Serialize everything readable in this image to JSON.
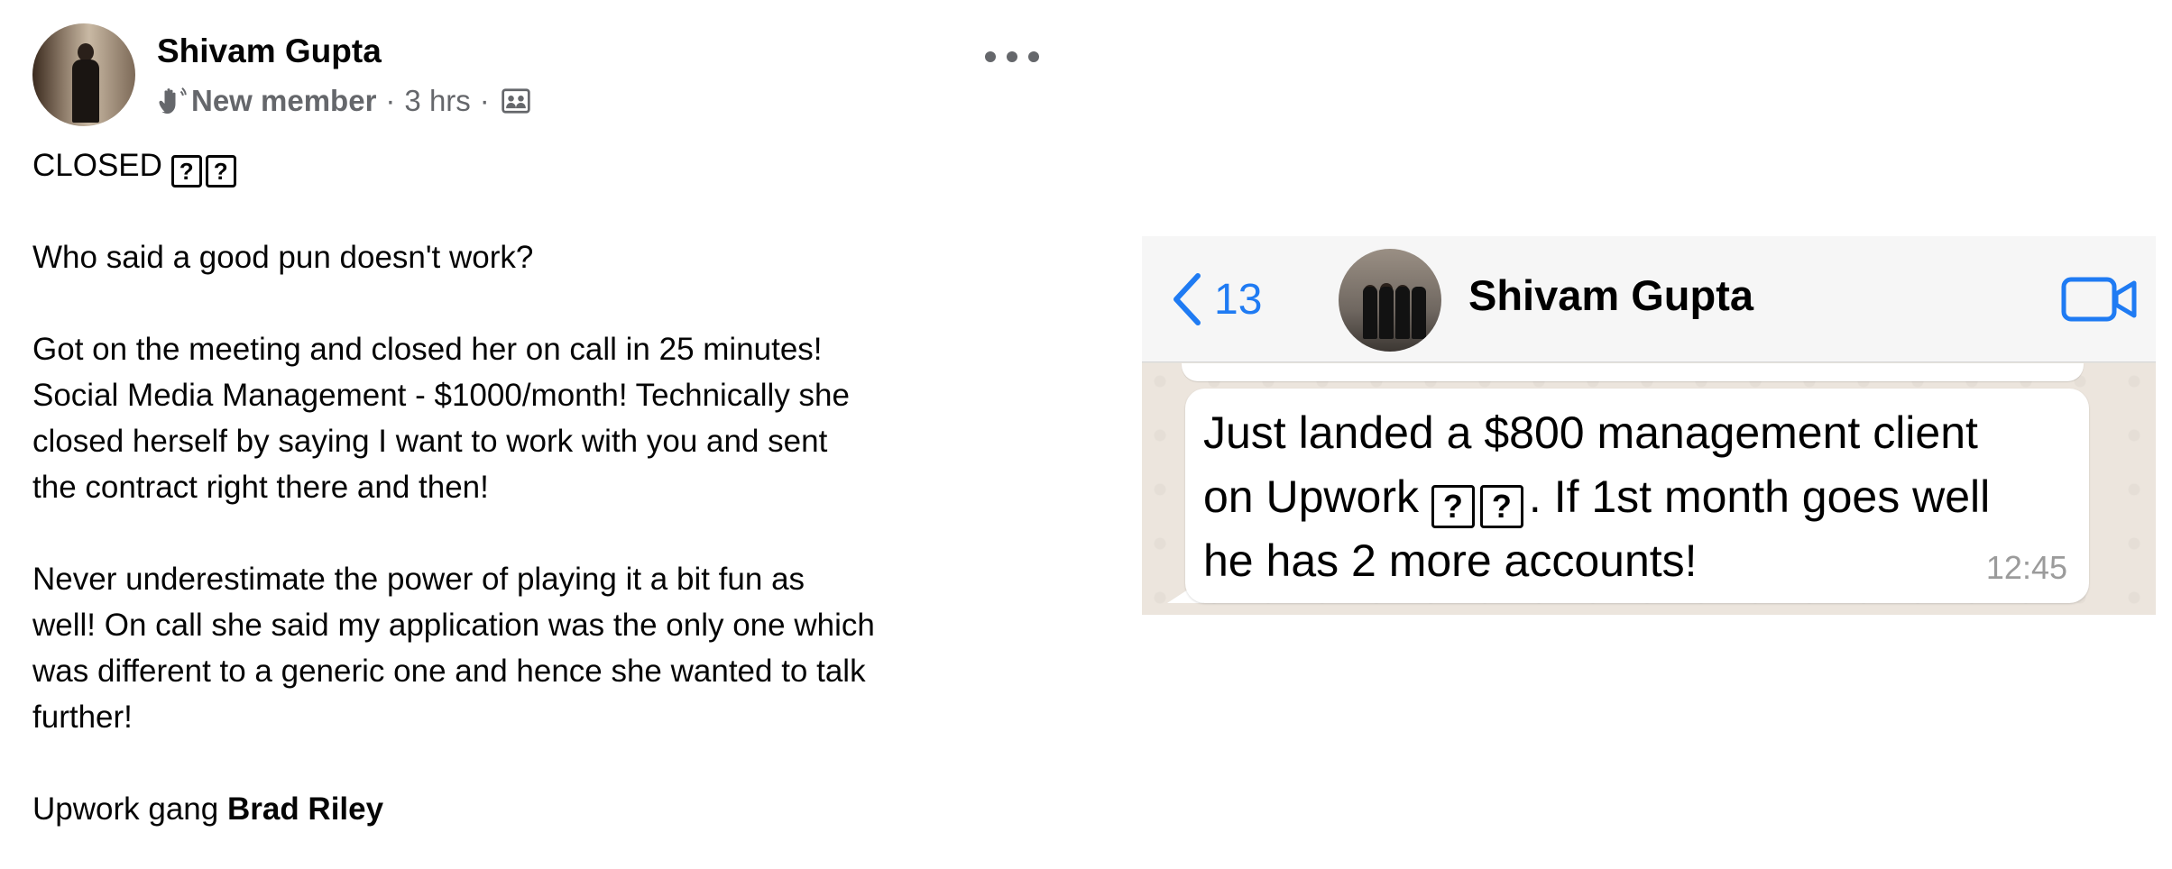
{
  "post": {
    "author": "Shivam Gupta",
    "badge": "New member",
    "separator": "·",
    "time": "3 hrs",
    "title_text": "CLOSED",
    "unknown_glyph": "?",
    "paragraphs": {
      "p1": "Who said a good pun doesn't work?",
      "p2_line1": "Got on the meeting and closed her on call in 25 minutes!",
      "p2_line2": "Social Media Management - $1000/month! Technically she",
      "p2_line3": "closed herself by saying I want to work with you and sent",
      "p2_line4": "the contract right there and then!",
      "p3_line1": "Never underestimate the power of playing it a bit fun as",
      "p3_line2": "well! On call she said my application was the only one which",
      "p3_line3": "was different to a generic one and hence she wanted to talk",
      "p3_line4": "further!",
      "p4_text": "Upwork gang",
      "p4_mention": "Brad Riley"
    }
  },
  "chat": {
    "back_count": "13",
    "contact_name": "Shivam Gupta",
    "message_line1": "Just landed a $800 management client",
    "message_line2_pre": "on Upwork",
    "message_line2_post": ". If 1st month goes well",
    "message_line3": "he has 2 more accounts!",
    "message_time": "12:45",
    "accent_color": "#1f7bf3"
  },
  "icons": [
    "waving-hand-icon",
    "group-icon",
    "more-options-icon",
    "back-chevron-icon",
    "video-call-icon"
  ]
}
